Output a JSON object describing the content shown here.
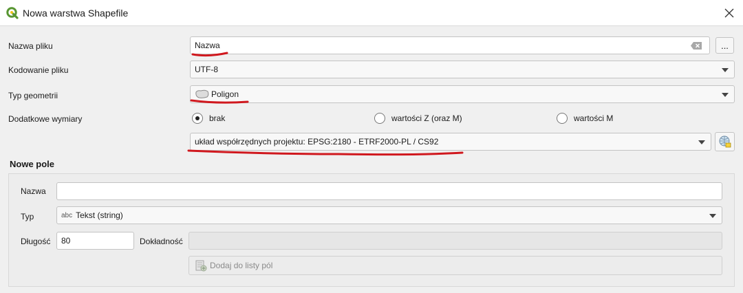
{
  "window": {
    "title": "Nowa warstwa Shapefile"
  },
  "file_name": {
    "label": "Nazwa pliku",
    "value": "Nazwa",
    "browse_label": "..."
  },
  "encoding": {
    "label": "Kodowanie pliku",
    "value": "UTF-8"
  },
  "geometry_type": {
    "label": "Typ geometrii",
    "value": "Poligon"
  },
  "dimensions": {
    "label": "Dodatkowe wymiary",
    "options": [
      "brak",
      "wartości Z (oraz M)",
      "wartości M"
    ],
    "selected": "brak"
  },
  "crs": {
    "value": "układ współrzędnych projektu: EPSG:2180 - ETRF2000-PL / CS92"
  },
  "new_field": {
    "title": "Nowe pole",
    "name_label": "Nazwa",
    "name_value": "",
    "type_label": "Typ",
    "type_prefix": "abc",
    "type_value": "Tekst (string)",
    "length_label": "Długość",
    "length_value": "80",
    "precision_label": "Dokładność",
    "add_button_label": "Dodaj do listy pól"
  },
  "colors": {
    "annotation": "#d0181e",
    "qgis_green": "#589632"
  }
}
